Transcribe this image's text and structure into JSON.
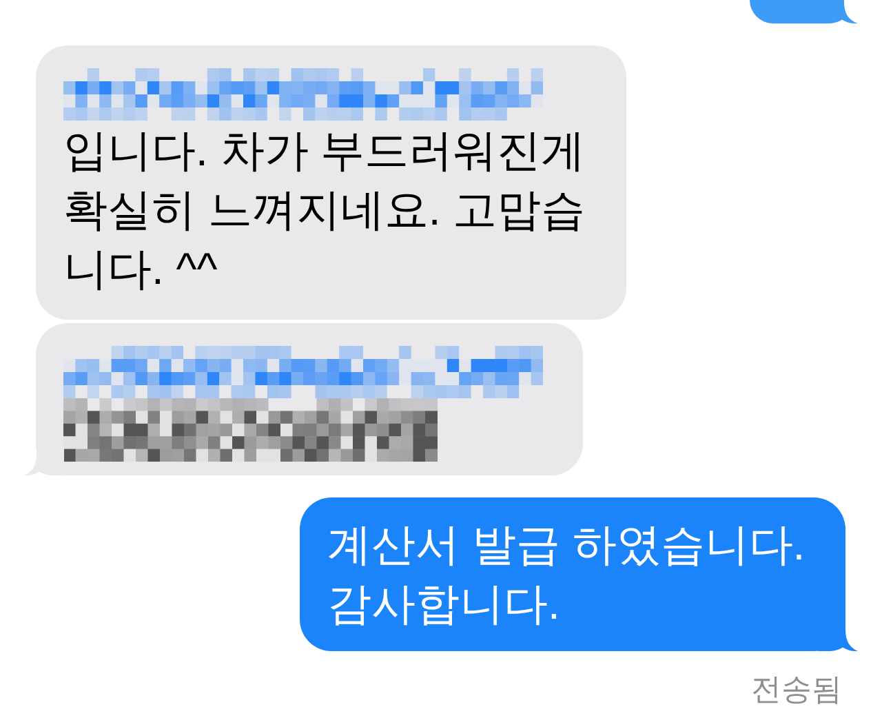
{
  "messages": [
    {
      "kind": "outgoing",
      "cropped": true,
      "tail": true
    },
    {
      "kind": "incoming",
      "tail": false,
      "parts": [
        {
          "kind": "redacted",
          "color": "#2f86f9"
        },
        {
          "kind": "text",
          "text": "입니다. 차가 부드러워진게 확실히 느껴지네요. 고맙습니다. ^^"
        }
      ]
    },
    {
      "kind": "incoming",
      "tail": true,
      "parts": [
        {
          "kind": "redacted",
          "color": "#2f86f9"
        },
        {
          "kind": "redacted",
          "color": "#555557"
        }
      ]
    },
    {
      "kind": "outgoing",
      "tail": true,
      "parts": [
        {
          "kind": "text",
          "text": "계산서 발급 하였습니다. 감사합니다."
        }
      ],
      "receipt": "전송됨"
    }
  ]
}
